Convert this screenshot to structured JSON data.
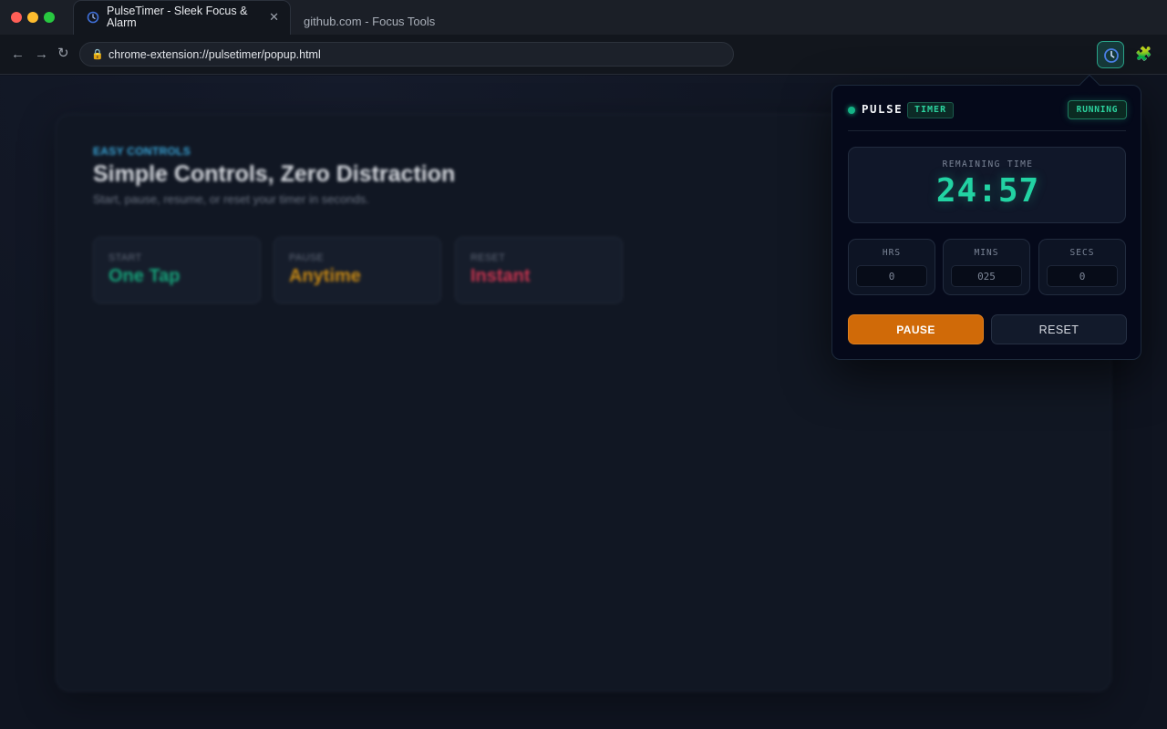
{
  "browser": {
    "active_tab": {
      "title": "PulseTimer - Sleek Focus & Alarm",
      "close_glyph": "✕"
    },
    "inactive_tab": {
      "title": "github.com - Focus Tools"
    },
    "nav": {
      "back": "←",
      "forward": "→",
      "reload": "↻"
    },
    "url": "chrome-extension://pulsetimer/popup.html",
    "lock_glyph": "🔒",
    "puzzle_glyph": "🧩"
  },
  "page": {
    "eyebrow": "EASY CONTROLS",
    "title": "Simple Controls, Zero Distraction",
    "subtitle": "Start, pause, resume, or reset your timer in seconds.",
    "features": [
      {
        "label": "START",
        "value": "One Tap",
        "color": "#16a37a"
      },
      {
        "label": "PAUSE",
        "value": "Anytime",
        "color": "#c98a14"
      },
      {
        "label": "RESET",
        "value": "Instant",
        "color": "#c9344f"
      }
    ]
  },
  "popup": {
    "brand_name": "PULSE",
    "brand_tag": "TIMER",
    "status": "RUNNING",
    "remaining_label": "REMAINING TIME",
    "remaining_value": "24:57",
    "fields": {
      "hours": {
        "label": "HRS",
        "value": "0"
      },
      "minutes": {
        "label": "MINS",
        "value": "025"
      },
      "seconds": {
        "label": "SECS",
        "value": "0"
      }
    },
    "pause_label": "PAUSE",
    "reset_label": "RESET"
  },
  "colors": {
    "accent": "#22d3a3",
    "pause_button": "#d06a08",
    "background": "#0f1420"
  },
  "icons": {
    "extension": "timer-icon",
    "favicon": "timer-icon",
    "extensions_menu": "puzzle-icon"
  }
}
